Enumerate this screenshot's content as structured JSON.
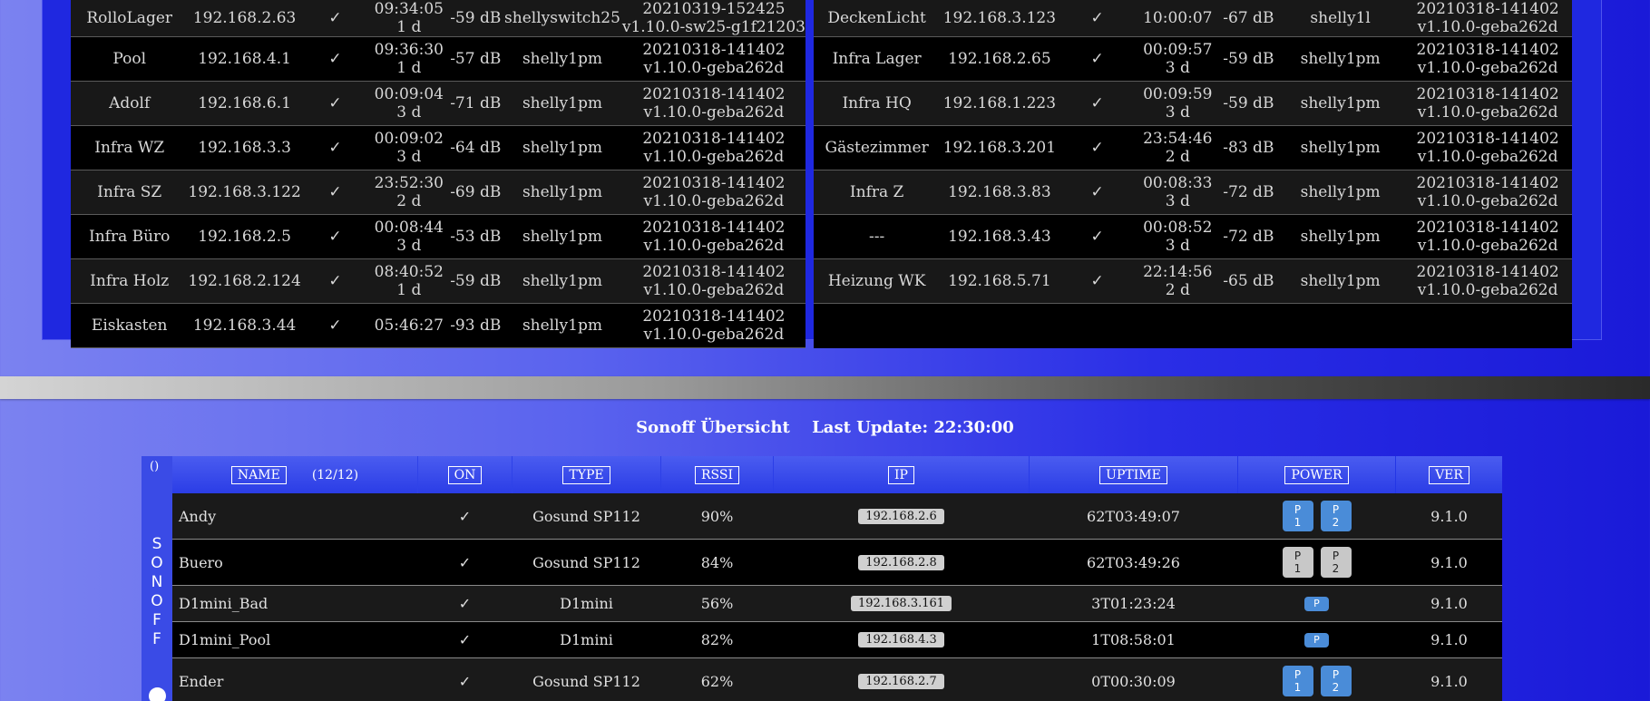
{
  "shelly": {
    "left_rows": [
      {
        "name": "RolloLager",
        "ip": "192.168.2.63",
        "ok": "✓",
        "uptime": [
          "09:34:05",
          "1 d"
        ],
        "rssi": "-59 dB",
        "type": "shellyswitch25",
        "fw": [
          "20210319-152425",
          "v1.10.0-sw25-g1f21203"
        ]
      },
      {
        "name": "Pool",
        "ip": "192.168.4.1",
        "ok": "✓",
        "uptime": [
          "09:36:30",
          "1 d"
        ],
        "rssi": "-57 dB",
        "type": "shelly1pm",
        "fw": [
          "20210318-141402",
          "v1.10.0-geba262d"
        ]
      },
      {
        "name": "Adolf",
        "ip": "192.168.6.1",
        "ok": "✓",
        "uptime": [
          "00:09:04",
          "3 d"
        ],
        "rssi": "-71 dB",
        "type": "shelly1pm",
        "fw": [
          "20210318-141402",
          "v1.10.0-geba262d"
        ]
      },
      {
        "name": "Infra WZ",
        "ip": "192.168.3.3",
        "ok": "✓",
        "uptime": [
          "00:09:02",
          "3 d"
        ],
        "rssi": "-64 dB",
        "type": "shelly1pm",
        "fw": [
          "20210318-141402",
          "v1.10.0-geba262d"
        ]
      },
      {
        "name": "Infra SZ",
        "ip": "192.168.3.122",
        "ok": "✓",
        "uptime": [
          "23:52:30",
          "2 d"
        ],
        "rssi": "-69 dB",
        "type": "shelly1pm",
        "fw": [
          "20210318-141402",
          "v1.10.0-geba262d"
        ]
      },
      {
        "name": "Infra Büro",
        "ip": "192.168.2.5",
        "ok": "✓",
        "uptime": [
          "00:08:44",
          "3 d"
        ],
        "rssi": "-53 dB",
        "type": "shelly1pm",
        "fw": [
          "20210318-141402",
          "v1.10.0-geba262d"
        ]
      },
      {
        "name": "Infra Holz",
        "ip": "192.168.2.124",
        "ok": "✓",
        "uptime": [
          "08:40:52",
          "1 d"
        ],
        "rssi": "-59 dB",
        "type": "shelly1pm",
        "fw": [
          "20210318-141402",
          "v1.10.0-geba262d"
        ]
      },
      {
        "name": "Eiskasten",
        "ip": "192.168.3.44",
        "ok": "✓",
        "uptime": [
          "05:46:27",
          ""
        ],
        "rssi": "-93 dB",
        "type": "shelly1pm",
        "fw": [
          "20210318-141402",
          "v1.10.0-geba262d"
        ]
      }
    ],
    "right_rows": [
      {
        "name": "DeckenLicht",
        "ip": "192.168.3.123",
        "ok": "✓",
        "uptime": [
          "10:00:07",
          ""
        ],
        "rssi": "-67 dB",
        "type": "shelly1l",
        "fw": [
          "20210318-141402",
          "v1.10.0-geba262d"
        ]
      },
      {
        "name": "Infra Lager",
        "ip": "192.168.2.65",
        "ok": "✓",
        "uptime": [
          "00:09:57",
          "3 d"
        ],
        "rssi": "-59 dB",
        "type": "shelly1pm",
        "fw": [
          "20210318-141402",
          "v1.10.0-geba262d"
        ]
      },
      {
        "name": "Infra HQ",
        "ip": "192.168.1.223",
        "ok": "✓",
        "uptime": [
          "00:09:59",
          "3 d"
        ],
        "rssi": "-59 dB",
        "type": "shelly1pm",
        "fw": [
          "20210318-141402",
          "v1.10.0-geba262d"
        ]
      },
      {
        "name": "Gästezimmer",
        "ip": "192.168.3.201",
        "ok": "✓",
        "uptime": [
          "23:54:46",
          "2 d"
        ],
        "rssi": "-83 dB",
        "type": "shelly1pm",
        "fw": [
          "20210318-141402",
          "v1.10.0-geba262d"
        ]
      },
      {
        "name": "Infra Z",
        "ip": "192.168.3.83",
        "ok": "✓",
        "uptime": [
          "00:08:33",
          "3 d"
        ],
        "rssi": "-72 dB",
        "type": "shelly1pm",
        "fw": [
          "20210318-141402",
          "v1.10.0-geba262d"
        ]
      },
      {
        "name": "---",
        "ip": "192.168.3.43",
        "ok": "✓",
        "uptime": [
          "00:08:52",
          "3 d"
        ],
        "rssi": "-72 dB",
        "type": "shelly1pm",
        "fw": [
          "20210318-141402",
          "v1.10.0-geba262d"
        ]
      },
      {
        "name": "Heizung WK",
        "ip": "192.168.5.71",
        "ok": "✓",
        "uptime": [
          "22:14:56",
          "2 d"
        ],
        "rssi": "-65 dB",
        "type": "shelly1pm",
        "fw": [
          "20210318-141402",
          "v1.10.0-geba262d"
        ]
      }
    ]
  },
  "sonoff": {
    "title": "Sonoff Übersicht",
    "last_update": "Last Update: 22:30:00",
    "strip_toggle": "()",
    "strip_label": [
      "S",
      "O",
      "N",
      "O",
      "F",
      "F"
    ],
    "headers": {
      "name": "NAME",
      "count": "(12/12)",
      "on": "ON",
      "type": "TYPE",
      "rssi": "RSSI",
      "ip": "IP",
      "uptime": "UPTIME",
      "power": "POWER",
      "ver": "VER"
    },
    "rows": [
      {
        "name": "Andy",
        "on": "✓",
        "type": "Gosund SP112",
        "rssi": "90%",
        "ip": "192.168.2.6",
        "uptime": "62T03:49:07",
        "power": [
          {
            "label": [
              "P",
              "1"
            ],
            "state": "on"
          },
          {
            "label": [
              "P",
              "2"
            ],
            "state": "on"
          }
        ],
        "ver": "9.1.0"
      },
      {
        "name": "Buero",
        "on": "✓",
        "type": "Gosund SP112",
        "rssi": "84%",
        "ip": "192.168.2.8",
        "uptime": "62T03:49:26",
        "power": [
          {
            "label": [
              "P",
              "1"
            ],
            "state": "off"
          },
          {
            "label": [
              "P",
              "2"
            ],
            "state": "off"
          }
        ],
        "ver": "9.1.0"
      },
      {
        "name": "D1mini_Bad",
        "on": "✓",
        "type": "D1mini",
        "rssi": "56%",
        "ip": "192.168.3.161",
        "uptime": "3T01:23:24",
        "power": [
          {
            "label": [
              "P"
            ],
            "state": "on"
          }
        ],
        "ver": "9.1.0"
      },
      {
        "name": "D1mini_Pool",
        "on": "✓",
        "type": "D1mini",
        "rssi": "82%",
        "ip": "192.168.4.3",
        "uptime": "1T08:58:01",
        "power": [
          {
            "label": [
              "P"
            ],
            "state": "on"
          }
        ],
        "ver": "9.1.0"
      },
      {
        "name": "Ender",
        "on": "✓",
        "type": "Gosund SP112",
        "rssi": "62%",
        "ip": "192.168.2.7",
        "uptime": "0T00:30:09",
        "power": [
          {
            "label": [
              "P",
              "1"
            ],
            "state": "on"
          },
          {
            "label": [
              "P",
              "2"
            ],
            "state": "on"
          }
        ],
        "ver": "9.1.0"
      }
    ]
  }
}
